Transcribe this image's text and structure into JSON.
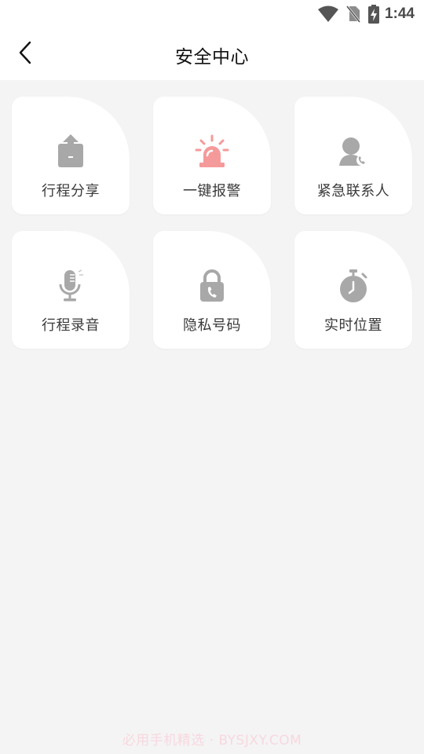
{
  "status_bar": {
    "time": "1:44",
    "icons": [
      "wifi-icon",
      "no-sim-icon",
      "battery-charging-icon"
    ]
  },
  "header": {
    "back_icon": "chevron-left-icon",
    "title": "安全中心"
  },
  "features": [
    {
      "label": "行程分享",
      "icon": "share-upload-icon",
      "color": "#a8a8a8"
    },
    {
      "label": "一键报警",
      "icon": "alarm-siren-icon",
      "color": "#f59a9a"
    },
    {
      "label": "紧急联系人",
      "icon": "emergency-contact-icon",
      "color": "#a8a8a8"
    },
    {
      "label": "行程录音",
      "icon": "microphone-icon",
      "color": "#a8a8a8"
    },
    {
      "label": "隐私号码",
      "icon": "privacy-phone-lock-icon",
      "color": "#a8a8a8"
    },
    {
      "label": "实时位置",
      "icon": "stopwatch-icon",
      "color": "#a8a8a8"
    }
  ],
  "watermark": "必用手机精选 · BYSJXY.COM"
}
